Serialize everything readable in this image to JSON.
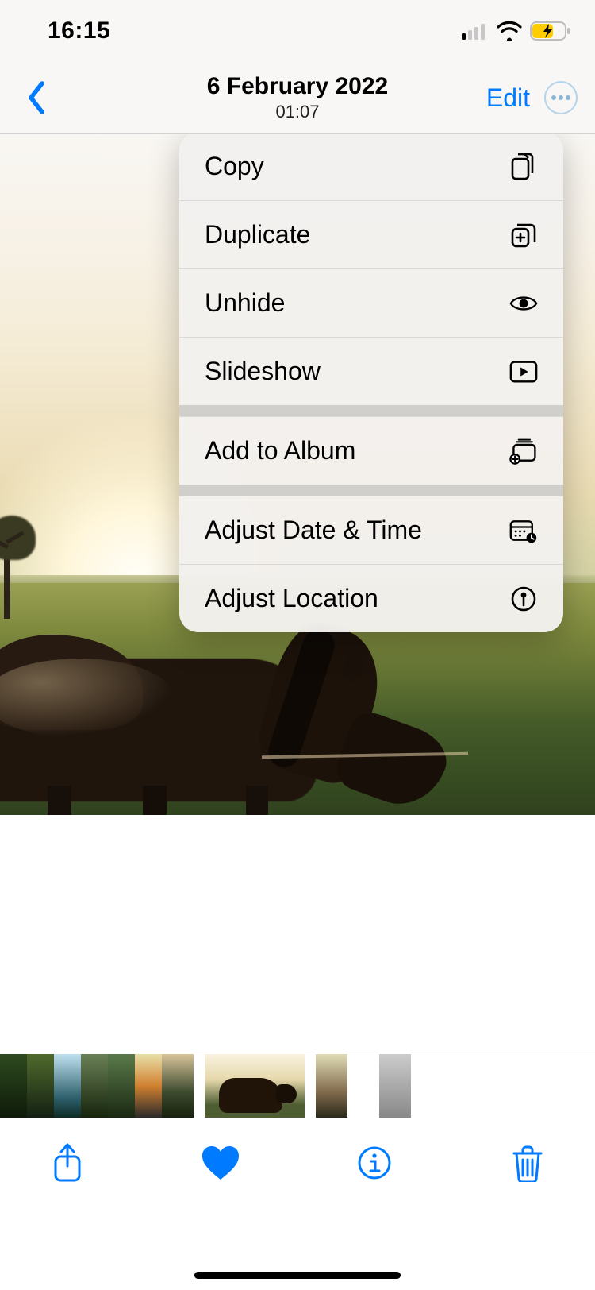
{
  "status": {
    "time": "16:15"
  },
  "nav": {
    "title": "6 February 2022",
    "subtitle": "01:07",
    "edit_label": "Edit"
  },
  "menu": {
    "groups": [
      [
        "Copy",
        "Duplicate",
        "Unhide",
        "Slideshow"
      ],
      [
        "Add to Album"
      ],
      [
        "Adjust Date & Time",
        "Adjust Location"
      ]
    ],
    "items": {
      "copy": "Copy",
      "duplicate": "Duplicate",
      "unhide": "Unhide",
      "slideshow": "Slideshow",
      "add_album": "Add to Album",
      "adjust_date": "Adjust Date & Time",
      "adjust_location": "Adjust Location"
    }
  }
}
